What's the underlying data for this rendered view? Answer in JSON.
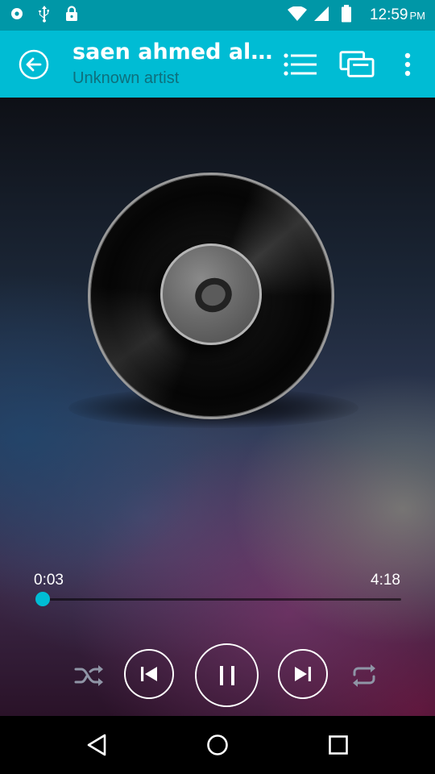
{
  "status_bar": {
    "time": "12:59",
    "ampm": "PM",
    "icons": [
      "sync-icon",
      "usb-icon",
      "lock-icon",
      "wifi-icon",
      "cell-signal-icon",
      "battery-icon"
    ]
  },
  "app_bar": {
    "title": "saen ahmed ali...",
    "subtitle": "Unknown artist",
    "icons": [
      "back-arrow-icon",
      "queue-list-icon",
      "cast-icon",
      "more-vert-icon"
    ],
    "accent_color": "#00bcd4",
    "status_color": "#0097a7"
  },
  "player": {
    "elapsed": "0:03",
    "duration": "4:18",
    "progress": 0.012,
    "state": "playing",
    "controls": [
      "shuffle-icon",
      "skip-previous-icon",
      "pause-icon",
      "skip-next-icon",
      "repeat-icon"
    ]
  },
  "nav_bar": {
    "icons": [
      "nav-back-icon",
      "nav-home-icon",
      "nav-recents-icon"
    ]
  }
}
